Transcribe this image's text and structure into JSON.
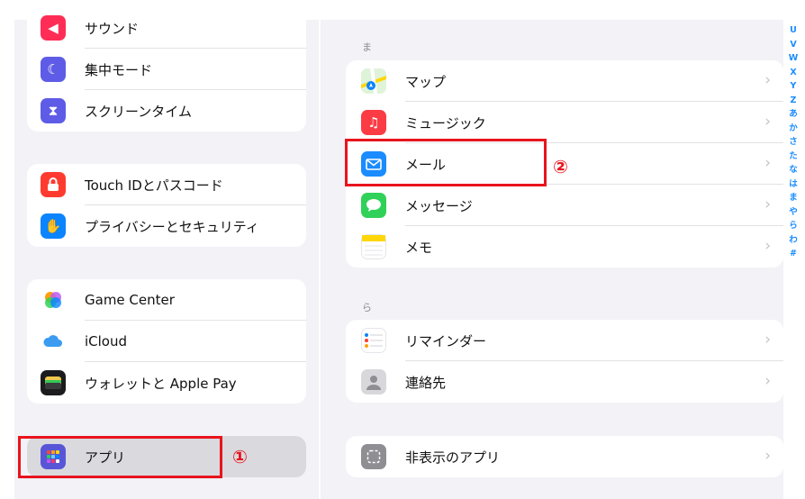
{
  "sidebar": {
    "group1": [
      {
        "label": "サウンド",
        "icon": "speaker-icon",
        "color": "#ff2d55"
      },
      {
        "label": "集中モード",
        "icon": "moon-icon",
        "color": "#5e5ce6"
      },
      {
        "label": "スクリーンタイム",
        "icon": "hourglass-icon",
        "color": "#5e5ce6"
      }
    ],
    "group2": [
      {
        "label": "Touch IDとパスコード",
        "icon": "lock-icon",
        "color": "#ff3b30"
      },
      {
        "label": "プライバシーとセキュリティ",
        "icon": "hand-icon",
        "color": "#0a84ff"
      }
    ],
    "group3": [
      {
        "label": "Game Center",
        "icon": "game-center-icon",
        "color": "#ffffff"
      },
      {
        "label": "iCloud",
        "icon": "cloud-icon",
        "color": "#ffffff"
      },
      {
        "label": "ウォレットと Apple Pay",
        "icon": "wallet-icon",
        "color": "#1c1c1e"
      }
    ],
    "group4": [
      {
        "label": "アプリ",
        "icon": "apps-grid-icon",
        "color": "#5856d6"
      }
    ]
  },
  "main": {
    "section_ma": {
      "header": "ま",
      "items": [
        {
          "label": "マップ",
          "icon": "maps-icon",
          "color": "#34c759"
        },
        {
          "label": "ミュージック",
          "icon": "music-icon",
          "color": "#fc3c44"
        },
        {
          "label": "メール",
          "icon": "mail-icon",
          "color": "#1a8cff"
        },
        {
          "label": "メッセージ",
          "icon": "messages-icon",
          "color": "#30d158"
        },
        {
          "label": "メモ",
          "icon": "notes-icon",
          "color": "#ffd60a"
        }
      ]
    },
    "section_ra": {
      "header": "ら",
      "items": [
        {
          "label": "リマインダー",
          "icon": "reminders-icon",
          "color": "#ffffff"
        },
        {
          "label": "連絡先",
          "icon": "contacts-icon",
          "color": "#d1d1d6"
        }
      ]
    },
    "hidden": {
      "items": [
        {
          "label": "非表示のアプリ",
          "icon": "hidden-apps-icon",
          "color": "#8e8e93"
        }
      ]
    }
  },
  "index_bar": [
    "U",
    "V",
    "W",
    "X",
    "Y",
    "Z",
    "あ",
    "か",
    "さ",
    "た",
    "な",
    "は",
    "ま",
    "や",
    "ら",
    "わ",
    "#"
  ],
  "annotations": {
    "marker1": "①",
    "marker2": "②",
    "color": "#e8141d"
  }
}
